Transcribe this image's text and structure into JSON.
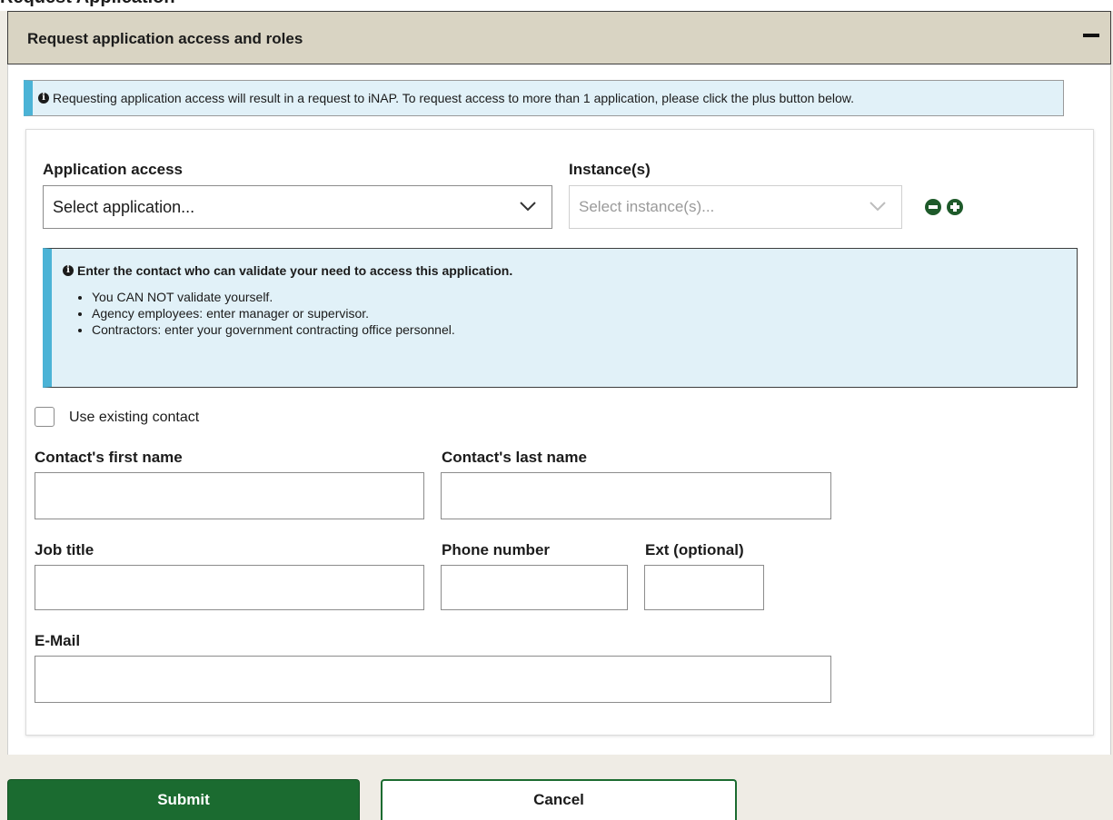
{
  "page": {
    "partial_heading": "Request Application"
  },
  "panel": {
    "title": "Request application access and roles"
  },
  "info_banner": {
    "text": "Requesting application access will result in a request to iNAP. To request access to more than 1 application, please click the plus button below."
  },
  "application_access": {
    "label": "Application access",
    "placeholder": "Select application..."
  },
  "instances": {
    "label": "Instance(s)",
    "placeholder": "Select instance(s)..."
  },
  "contact_info": {
    "heading": "Enter the contact who can validate your need to access this application.",
    "bullets": [
      "You CAN NOT validate yourself.",
      "Agency employees: enter manager or supervisor.",
      "Contractors: enter your government contracting office personnel."
    ]
  },
  "use_existing_contact": {
    "label": "Use existing contact",
    "checked": false
  },
  "form": {
    "first_name_label": "Contact's first name",
    "last_name_label": "Contact's last name",
    "job_title_label": "Job title",
    "phone_label": "Phone number",
    "ext_label": "Ext (optional)",
    "email_label": "E-Mail"
  },
  "buttons": {
    "submit": "Submit",
    "cancel": "Cancel"
  },
  "colors": {
    "header_bg": "#d9d4c3",
    "info_bg": "#e1f1f8",
    "info_accent": "#4bb3d6",
    "primary_green": "#1b6b30",
    "page_bg": "#efece5"
  }
}
